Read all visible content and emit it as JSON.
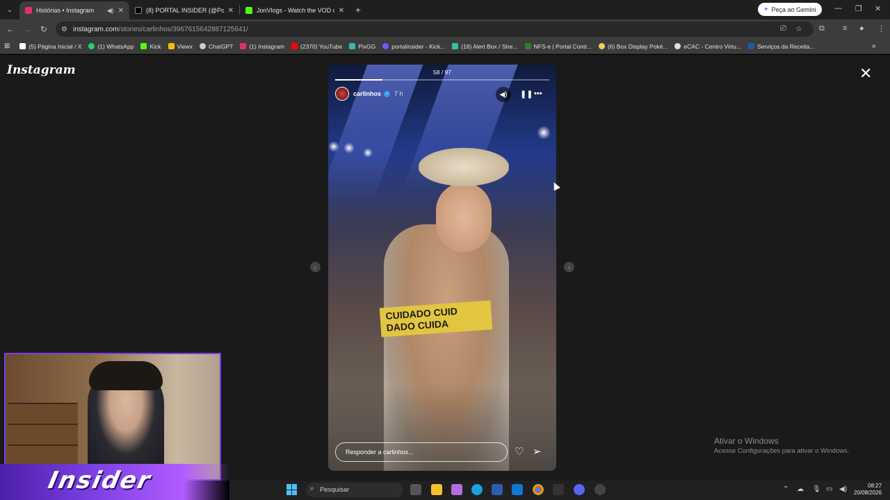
{
  "browser": {
    "tabs": [
      {
        "title": "Histórias • Instagram",
        "color": "#e1306c",
        "active": true
      },
      {
        "title": "(8) PORTAL INSIDER (@Portal_I",
        "color": "#000000",
        "active": false
      },
      {
        "title": "JonVlogs - Watch the VOD on",
        "color": "#53fc18",
        "active": false
      }
    ],
    "gemini_button": "Peça ao Gemini",
    "url_domain": "instagram.com",
    "url_path": "/stories/carlinhos/3967615642887125641/",
    "bookmarks": [
      {
        "label": "(5) Página Inicial / X",
        "color": "#ffffff"
      },
      {
        "label": "(1) WhatsApp",
        "color": "#25d366"
      },
      {
        "label": "Kick",
        "color": "#53fc18"
      },
      {
        "label": "Viewx",
        "color": "#f0c000"
      },
      {
        "label": "ChatGPT",
        "color": "#cccccc"
      },
      {
        "label": "(1) Instagram",
        "color": "#e1306c"
      },
      {
        "label": "(2370) YouTube",
        "color": "#ff0000"
      },
      {
        "label": "PixGG",
        "color": "#32bcad"
      },
      {
        "label": "portalinsider - Kick...",
        "color": "#6a5cff"
      },
      {
        "label": "(18) Alert Box / Stre...",
        "color": "#31c3a2"
      },
      {
        "label": "NFS-e | Portal Contr...",
        "color": "#2e7d32"
      },
      {
        "label": "(6) Box Display Poké...",
        "color": "#f0d060"
      },
      {
        "label": "eCAC - Centro Virtu...",
        "color": "#e0e0e0"
      },
      {
        "label": "Serviços da Receita...",
        "color": "#1e5aa8"
      }
    ]
  },
  "instagram": {
    "logo": "Instagram",
    "story": {
      "counter": "58 / 97",
      "progress": 0.22,
      "username": "carlinhos",
      "time_ago": "7 h",
      "tape_line1": "CUIDADO CUID",
      "tape_line2": "DADO CUIDA",
      "reply_placeholder": "Responder a carlinhos..."
    }
  },
  "windows": {
    "activation_title": "Ativar o Windows",
    "activation_sub": "Acesse Configurações para ativar o Windows.",
    "search_placeholder": "Pesquisar",
    "time": "08:27",
    "date": "20/08/2026"
  },
  "overlay": {
    "brand_text": "Insider"
  }
}
